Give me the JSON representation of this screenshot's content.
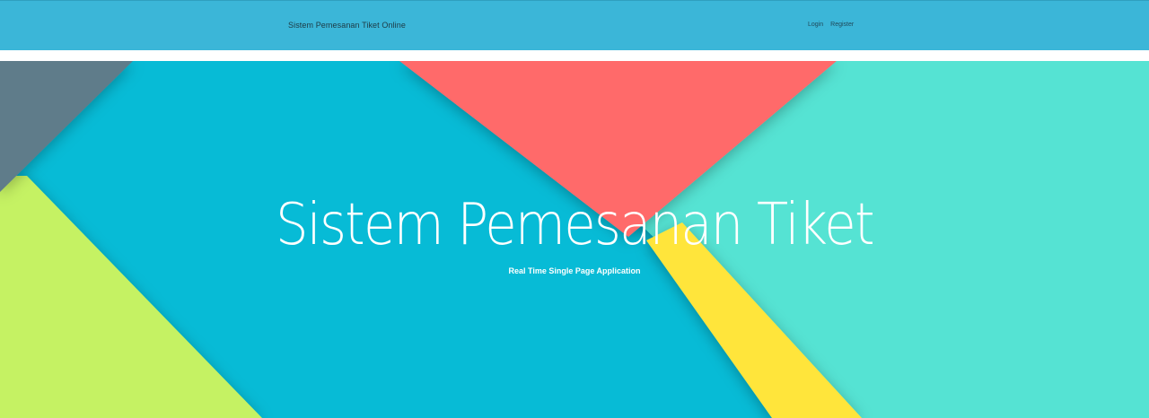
{
  "navbar": {
    "brand": "Sistem Pemesanan Tiket Online",
    "links": [
      "Login",
      "Register"
    ],
    "background": "#3bb6d8"
  },
  "hero": {
    "title": "Sistem Pemesanan Tiket",
    "subtitle": "Real Time Single Page Application",
    "colors": {
      "cyan": "#07bbd6",
      "salmon": "#ff6b6b",
      "mint": "#55e3d3",
      "lime": "#c5f263",
      "slate": "#5f7c8a",
      "yellow": "#ffe53b"
    }
  }
}
